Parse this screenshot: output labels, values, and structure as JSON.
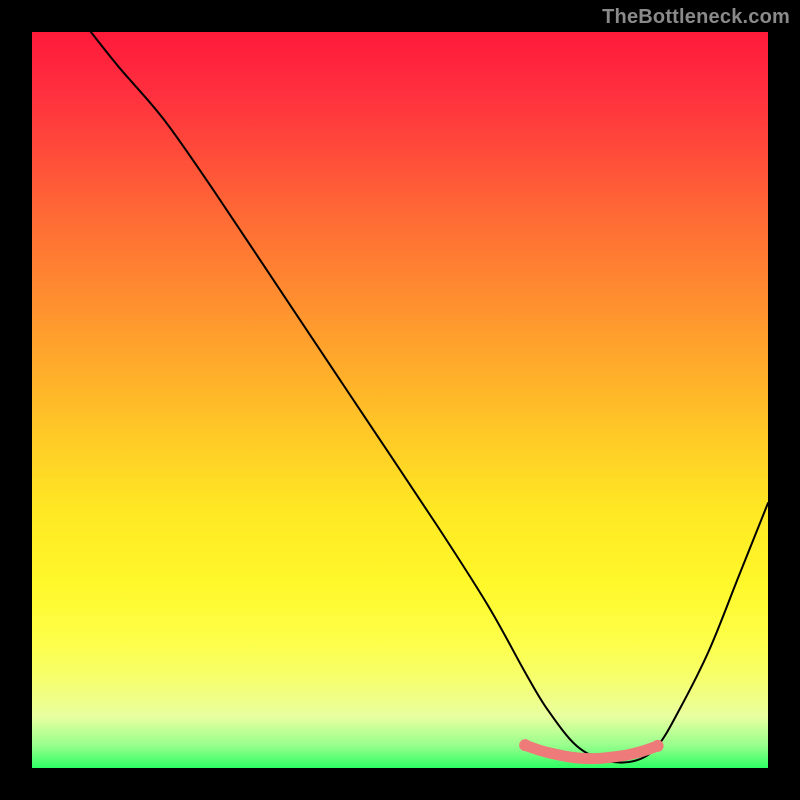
{
  "watermark": "TheBottleneck.com",
  "chart_data": {
    "type": "line",
    "title": "",
    "xlabel": "",
    "ylabel": "",
    "xlim": [
      0,
      100
    ],
    "ylim": [
      0,
      100
    ],
    "grid": false,
    "legend": false,
    "series": [
      {
        "name": "curve",
        "color": "#000000",
        "x": [
          8,
          12,
          18,
          25,
          35,
          45,
          55,
          62,
          67,
          70,
          74,
          78,
          82,
          85,
          88,
          92,
          96,
          100
        ],
        "y": [
          100,
          95,
          88,
          78,
          63,
          48,
          33,
          22,
          13,
          8,
          3,
          1,
          1,
          3,
          8,
          16,
          26,
          36
        ]
      }
    ],
    "highlight": {
      "name": "optimal-range",
      "color": "#ef7a7a",
      "x": [
        67,
        69,
        71,
        73,
        75,
        77,
        79,
        81,
        83,
        85
      ],
      "y": [
        3.1,
        2.4,
        1.9,
        1.5,
        1.3,
        1.3,
        1.5,
        1.8,
        2.3,
        3.0
      ]
    }
  }
}
